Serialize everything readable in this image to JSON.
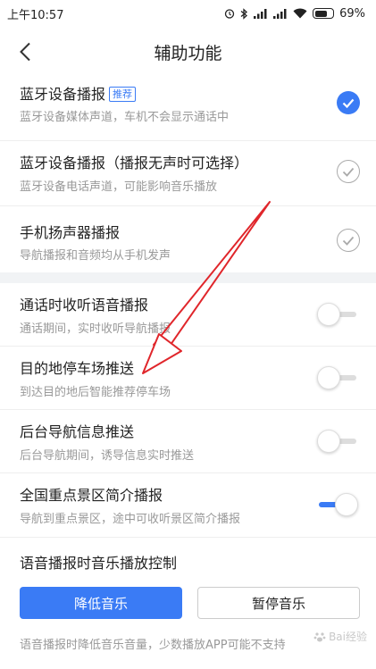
{
  "status_bar": {
    "time": "上午10:57",
    "battery_text": "69%",
    "battery_level": 0.69,
    "icons": [
      "alarm-icon",
      "bluetooth-icon",
      "signal-icon",
      "signal-icon",
      "wifi-icon",
      "battery-icon"
    ]
  },
  "header": {
    "title": "辅助功能",
    "back_icon": "chevron-left-icon"
  },
  "bluetooth_section": [
    {
      "title": "蓝牙设备播报",
      "tag": "推荐",
      "subtitle": "蓝牙设备媒体声道，车机不会显示通话中",
      "checked": true
    },
    {
      "title": "蓝牙设备播报（播报无声时可选择）",
      "subtitle": "蓝牙设备电话声道，可能影响音乐播放",
      "checked": false
    },
    {
      "title": "手机扬声器播报",
      "subtitle": "导航播报和音频均从手机发声",
      "checked": false
    }
  ],
  "toggle_section": [
    {
      "title": "通话时收听语音播报",
      "subtitle": "通话期间，实时收听导航播报",
      "on": false
    },
    {
      "title": "目的地停车场推送",
      "subtitle": "到达目的地后智能推荐停车场",
      "on": false
    },
    {
      "title": "后台导航信息推送",
      "subtitle": "后台导航期间，诱导信息实时推送",
      "on": false
    },
    {
      "title": "全国重点景区简介播报",
      "subtitle": "导航到重点景区，途中可收听景区简介播报",
      "on": true
    }
  ],
  "music_control": {
    "title": "语音播报时音乐播放控制",
    "options": [
      "降低音乐",
      "暂停音乐"
    ],
    "selected": "降低音乐",
    "note": "语音播报时降低音乐音量，少数播放APP可能不支持"
  },
  "watermark": "Bai经验",
  "colors": {
    "accent": "#3a7bf5",
    "annotation_arrow": "#e0262b",
    "section_band": "#f1f3f5"
  }
}
